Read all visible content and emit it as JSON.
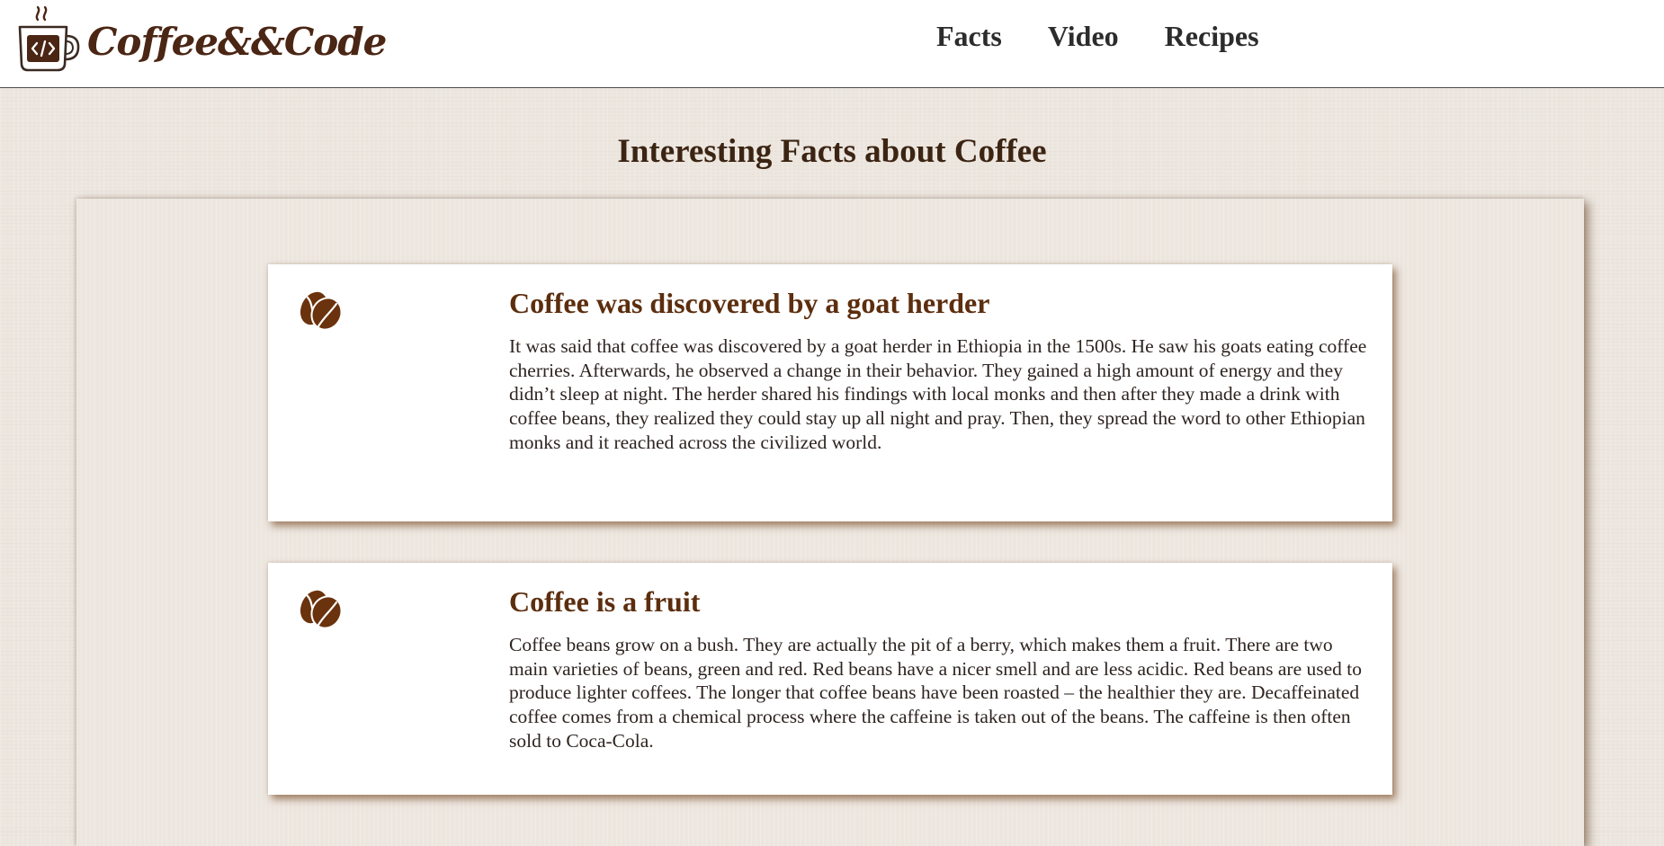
{
  "header": {
    "logo_text": "Coffee&&Code",
    "logo_icon": "coffee-mug-code-icon",
    "nav": [
      {
        "label": "Facts"
      },
      {
        "label": "Video"
      },
      {
        "label": "Recipes"
      }
    ]
  },
  "main": {
    "title": "Interesting Facts about Coffee",
    "facts": [
      {
        "icon": "coffee-bean-icon",
        "title": "Coffee was discovered by a goat herder",
        "text": "It was said that coffee was discovered by a goat herder in Ethiopia in the 1500s. He saw his goats eating coffee cherries. Afterwards, he observed a change in their behavior. They gained a high amount of energy and they didn’t sleep at night. The herder shared his findings with local monks and then after they made a drink with coffee beans, they realized they could stay up all night and pray. Then, they spread the word to other Ethiopian monks and it reached across the civilized world."
      },
      {
        "icon": "coffee-bean-icon",
        "title": "Coffee is a fruit",
        "text": "Coffee beans grow on a bush. They are actually the pit of a berry, which makes them a fruit. There are two main varieties of beans, green and red. Red beans have a nicer smell and are less acidic. Red beans are used to produce lighter coffees. The longer that coffee beans have been roasted – the healthier they are. Decaffeinated coffee comes from a chemical process where the caffeine is taken out of the beans. The caffeine is then often sold to Coca-Cola."
      }
    ]
  },
  "colors": {
    "brand_brown": "#5c2e0e",
    "background": "#ece6df",
    "header_bg": "#ffffff"
  }
}
